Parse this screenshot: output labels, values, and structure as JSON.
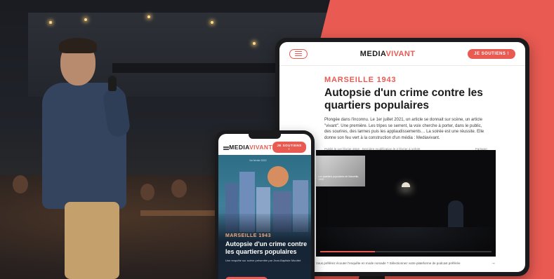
{
  "brand": {
    "logo_main": "MEDIA",
    "logo_accent": "VIVANT",
    "accent_color": "#e85a52"
  },
  "tablet": {
    "support_label": "JE SOUTIENS !",
    "kicker": "MARSEILLE 1943",
    "title": "Autopsie d'un crime contre les quartiers populaires",
    "lead": "Plongée dans l'inconnu. Le 1er juillet 2021, un article se donnait sur scène, un article \"vivant\". Une première. Les tripes se serrent, la voix cherche à porter, dans le public, des sourires, des larmes puis les applaudissements… La soirée est une réussite. Elle donne son feu vert à la construction d'un média : Mediavivant.",
    "meta_left": "Publié le 1er février 2022 · Dernière modification le 2 février à 14h30",
    "meta_right": "Partager",
    "video_slide_caption": "Les quartiers populaires de Marseille, 1943",
    "footer_text": "Vous préférez écouter l'enquête en mode nomade ? Sélectionnez votre plateforme de podcast préférée",
    "footer_arrow": "→"
  },
  "phone": {
    "support_label": "JE SOUTIENS !",
    "date": "1er février 2022",
    "kicker": "MARSEILLE 1943",
    "title": "Autopsie d'un crime contre les quartiers populaires",
    "byline": "Une enquête sur scène présentée par Jean-Baptiste Mouttet"
  },
  "video": {
    "progress": 0.32
  }
}
